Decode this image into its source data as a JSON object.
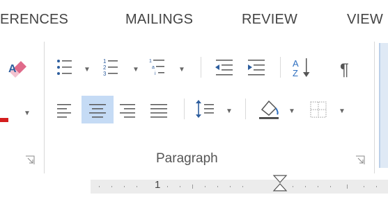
{
  "ribbon": {
    "tabs": [
      {
        "label": "ERENCES"
      },
      {
        "label": "MAILINGS"
      },
      {
        "label": "REVIEW"
      },
      {
        "label": "VIEW"
      }
    ]
  },
  "paragraph_group": {
    "label": "Paragraph",
    "selected_alignment": "center"
  },
  "ruler": {
    "marker_number": "1"
  },
  "colors": {
    "accent_selected": "#c5dbf5",
    "icon_blue": "#2e5e9e",
    "sort_blue": "#2e6fc0",
    "text": "#444444"
  }
}
